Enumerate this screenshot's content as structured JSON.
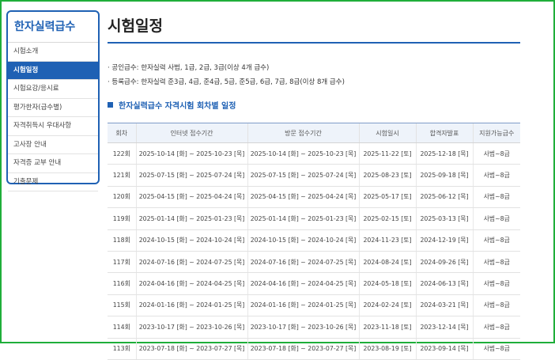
{
  "sidebar": {
    "title": "한자실력급수",
    "items": [
      {
        "label": "시험소개",
        "active": false
      },
      {
        "label": "시험일정",
        "active": true
      },
      {
        "label": "시험요강/응시료",
        "active": false
      },
      {
        "label": "평가한자(급수별)",
        "active": false
      },
      {
        "label": "자격취득시 우대사항",
        "active": false
      },
      {
        "label": "고사장 안내",
        "active": false
      },
      {
        "label": "자격증 교부 안내",
        "active": false
      },
      {
        "label": "기출문제",
        "active": false
      }
    ]
  },
  "page": {
    "title": "시험일정",
    "info": [
      "· 공인급수: 한자실력 사범, 1급, 2급, 3급(이상 4개 급수)",
      "· 등록급수: 한자실력 준3급, 4급, 준4급, 5급, 준5급, 6급, 7급, 8급(이상 8개 급수)"
    ],
    "section_title": "한자실력급수 자격시험 회차별 일정"
  },
  "table": {
    "headers": [
      "회차",
      "인터넷 접수기간",
      "방문 접수기간",
      "시험일시",
      "합격자발표",
      "지원가능급수"
    ],
    "rows": [
      [
        "122회",
        "2025-10-14 [화] ~ 2025-10-23 [목]",
        "2025-10-14 [화] ~ 2025-10-23 [목]",
        "2025-11-22 [토]",
        "2025-12-18 [목]",
        "사범~8급"
      ],
      [
        "121회",
        "2025-07-15 [화] ~ 2025-07-24 [목]",
        "2025-07-15 [화] ~ 2025-07-24 [목]",
        "2025-08-23 [토]",
        "2025-09-18 [목]",
        "사범~8급"
      ],
      [
        "120회",
        "2025-04-15 [화] ~ 2025-04-24 [목]",
        "2025-04-15 [화] ~ 2025-04-24 [목]",
        "2025-05-17 [토]",
        "2025-06-12 [목]",
        "사범~8급"
      ],
      [
        "119회",
        "2025-01-14 [화] ~ 2025-01-23 [목]",
        "2025-01-14 [화] ~ 2025-01-23 [목]",
        "2025-02-15 [토]",
        "2025-03-13 [목]",
        "사범~8급"
      ],
      [
        "118회",
        "2024-10-15 [화] ~ 2024-10-24 [목]",
        "2024-10-15 [화] ~ 2024-10-24 [목]",
        "2024-11-23 [토]",
        "2024-12-19 [목]",
        "사범~8급"
      ],
      [
        "117회",
        "2024-07-16 [화] ~ 2024-07-25 [목]",
        "2024-07-16 [화] ~ 2024-07-25 [목]",
        "2024-08-24 [토]",
        "2024-09-26 [목]",
        "사범~8급"
      ],
      [
        "116회",
        "2024-04-16 [화] ~ 2024-04-25 [목]",
        "2024-04-16 [화] ~ 2024-04-25 [목]",
        "2024-05-18 [토]",
        "2024-06-13 [목]",
        "사범~8급"
      ],
      [
        "115회",
        "2024-01-16 [화] ~ 2024-01-25 [목]",
        "2024-01-16 [화] ~ 2024-01-25 [목]",
        "2024-02-24 [토]",
        "2024-03-21 [목]",
        "사범~8급"
      ],
      [
        "114회",
        "2023-10-17 [화] ~ 2023-10-26 [목]",
        "2023-10-17 [화] ~ 2023-10-26 [목]",
        "2023-11-18 [토]",
        "2023-12-14 [목]",
        "사범~8급"
      ],
      [
        "113회",
        "2023-07-18 [화] ~ 2023-07-27 [목]",
        "2023-07-18 [화] ~ 2023-07-27 [목]",
        "2023-08-19 [토]",
        "2023-09-14 [목]",
        "사범~8급"
      ]
    ]
  },
  "colors": {
    "accent": "#1f61b4",
    "frame": "#1fae3a",
    "header_bg": "#eef3fa"
  }
}
